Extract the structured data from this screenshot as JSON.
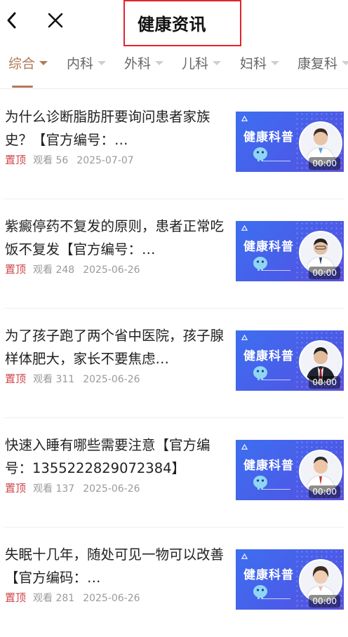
{
  "header": {
    "title": "健康资讯"
  },
  "tabs": [
    {
      "label": "综合",
      "active": true
    },
    {
      "label": "内科",
      "active": false
    },
    {
      "label": "外科",
      "active": false
    },
    {
      "label": "儿科",
      "active": false
    },
    {
      "label": "妇科",
      "active": false
    },
    {
      "label": "康复科",
      "active": false
    }
  ],
  "articles": [
    {
      "title": "为什么诊断脂肪肝要询问患者家族史？【官方编号：…",
      "pin": "置顶",
      "views": "观看 56",
      "date": "2025-07-07",
      "thumb_title": "健康科普",
      "duration": "00:00"
    },
    {
      "title": "紫癜停药不复发的原则，患者正常吃饭不复发【官方编号：…",
      "pin": "置顶",
      "views": "观看 248",
      "date": "2025-06-26",
      "thumb_title": "健康科普",
      "duration": "00:00"
    },
    {
      "title": "为了孩子跑了两个省中医院，孩子腺样体肥大，家长不要焦虑…",
      "pin": "置顶",
      "views": "观看 311",
      "date": "2025-06-26",
      "thumb_title": "健康科普",
      "duration": "00:00"
    },
    {
      "title": "快速入睡有哪些需要注意【官方编号：1355222829072384】",
      "pin": "置顶",
      "views": "观看 137",
      "date": "2025-06-26",
      "thumb_title": "健康科普",
      "duration": "00:00"
    },
    {
      "title": "失眠十几年，随处可见一物可以改善【官方编码：…",
      "pin": "置顶",
      "views": "观看 281",
      "date": "2025-06-26",
      "thumb_title": "健康科普",
      "duration": "00:00"
    }
  ],
  "icons": {
    "back": "chevron-left-icon",
    "close": "close-icon",
    "tab_dropdown": "caret-down-icon"
  },
  "colors": {
    "accent": "#b07a55",
    "pin": "#d0464a",
    "highlight_box": "#e0252b",
    "thumb_blue": "#3d6ff0"
  }
}
